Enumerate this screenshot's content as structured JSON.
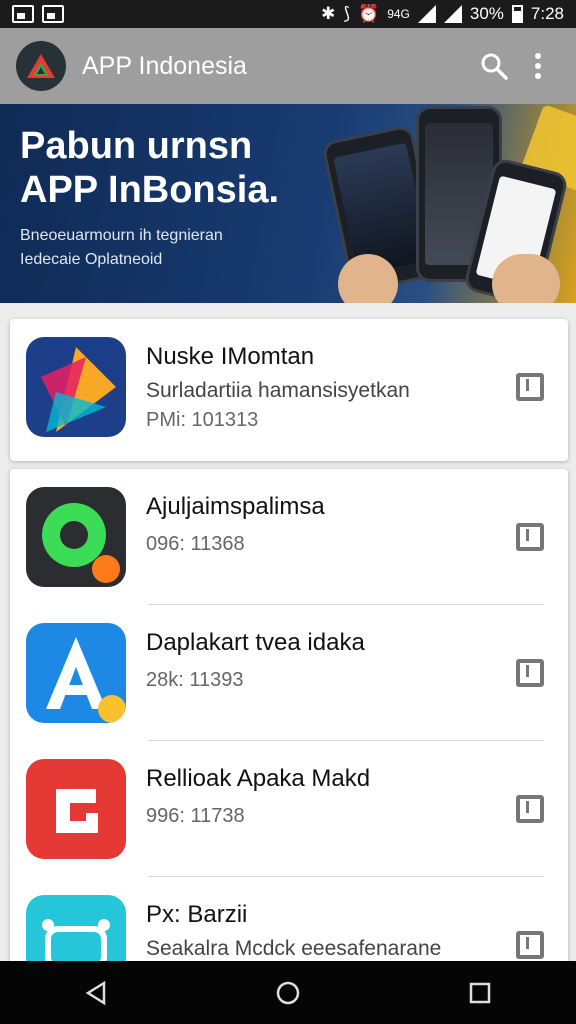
{
  "status_bar": {
    "battery": "30%",
    "time": "7:28",
    "network": "94G"
  },
  "app_bar": {
    "title": "APP Indonesia",
    "search_icon": "search-icon",
    "more_icon": "more-vert-icon"
  },
  "banner": {
    "title": "Pabun urnsn APP InBonsia.",
    "subtitle_line1": "Bneoeuarmourn ih tegnieran",
    "subtitle_line2": "Iedecaie Oplatneoid"
  },
  "apps": [
    {
      "name": "Nuske IMomtan",
      "subtitle": "Surladartiia hamansisyetkan",
      "meta": "PMi: 101313",
      "icon": "colorful-triangles-icon"
    },
    {
      "name": "Ajuljaimspalimsa",
      "subtitle": "",
      "meta": "096: 11368",
      "icon": "green-chat-bubble-icon"
    },
    {
      "name": "Daplakart tvea idaka",
      "subtitle": "",
      "meta": "28k: 11393",
      "icon": "blue-letter-a-icon"
    },
    {
      "name": "Rellioak Apaka Makd",
      "subtitle": "",
      "meta": "996: 11738",
      "icon": "red-shield-icon"
    },
    {
      "name": "Px: Barzii",
      "subtitle": "Seakalra Mcdck eeesafenarane",
      "meta": "",
      "icon": "cyan-robot-icon"
    }
  ],
  "nav": {
    "back": "back-icon",
    "home": "home-icon",
    "recents": "recents-icon"
  },
  "colors": {
    "app_bar": "#9e9e9e",
    "banner_dark": "#0f2a55",
    "accent_gold": "#f2c531"
  }
}
